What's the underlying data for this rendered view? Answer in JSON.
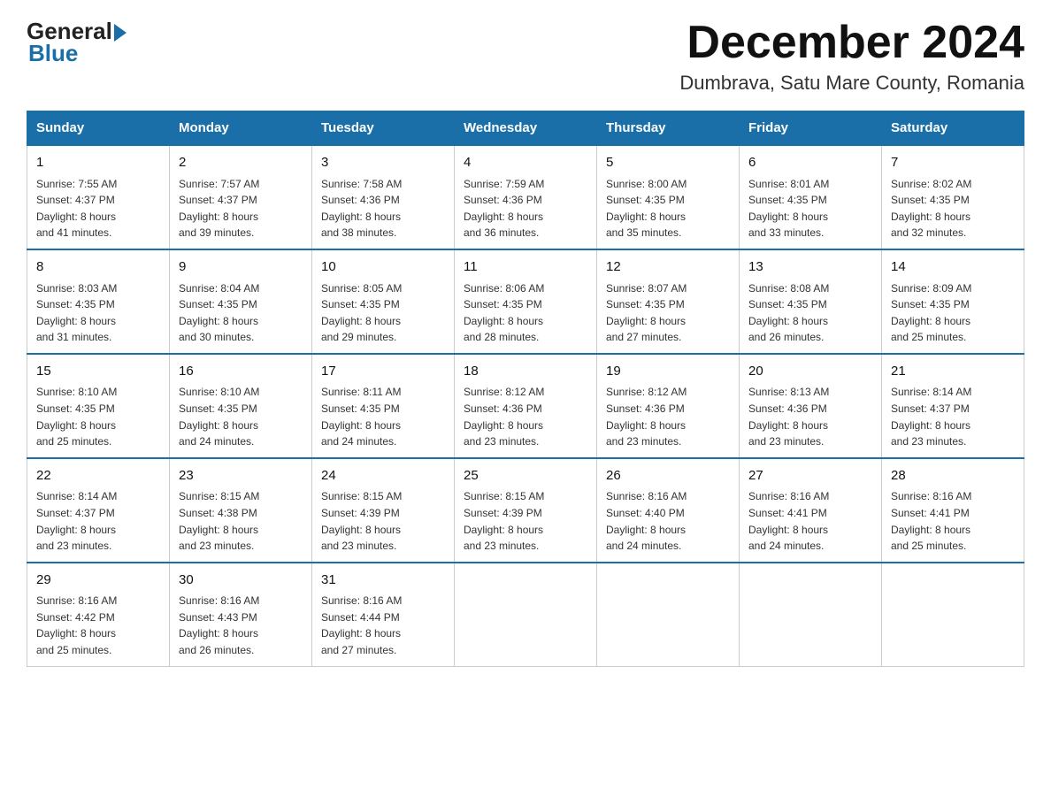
{
  "header": {
    "logo_general": "General",
    "logo_blue": "Blue",
    "title": "December 2024",
    "subtitle": "Dumbrava, Satu Mare County, Romania"
  },
  "days_of_week": [
    "Sunday",
    "Monday",
    "Tuesday",
    "Wednesday",
    "Thursday",
    "Friday",
    "Saturday"
  ],
  "weeks": [
    [
      {
        "day": "1",
        "sunrise": "7:55 AM",
        "sunset": "4:37 PM",
        "daylight": "8 hours and 41 minutes."
      },
      {
        "day": "2",
        "sunrise": "7:57 AM",
        "sunset": "4:37 PM",
        "daylight": "8 hours and 39 minutes."
      },
      {
        "day": "3",
        "sunrise": "7:58 AM",
        "sunset": "4:36 PM",
        "daylight": "8 hours and 38 minutes."
      },
      {
        "day": "4",
        "sunrise": "7:59 AM",
        "sunset": "4:36 PM",
        "daylight": "8 hours and 36 minutes."
      },
      {
        "day": "5",
        "sunrise": "8:00 AM",
        "sunset": "4:35 PM",
        "daylight": "8 hours and 35 minutes."
      },
      {
        "day": "6",
        "sunrise": "8:01 AM",
        "sunset": "4:35 PM",
        "daylight": "8 hours and 33 minutes."
      },
      {
        "day": "7",
        "sunrise": "8:02 AM",
        "sunset": "4:35 PM",
        "daylight": "8 hours and 32 minutes."
      }
    ],
    [
      {
        "day": "8",
        "sunrise": "8:03 AM",
        "sunset": "4:35 PM",
        "daylight": "8 hours and 31 minutes."
      },
      {
        "day": "9",
        "sunrise": "8:04 AM",
        "sunset": "4:35 PM",
        "daylight": "8 hours and 30 minutes."
      },
      {
        "day": "10",
        "sunrise": "8:05 AM",
        "sunset": "4:35 PM",
        "daylight": "8 hours and 29 minutes."
      },
      {
        "day": "11",
        "sunrise": "8:06 AM",
        "sunset": "4:35 PM",
        "daylight": "8 hours and 28 minutes."
      },
      {
        "day": "12",
        "sunrise": "8:07 AM",
        "sunset": "4:35 PM",
        "daylight": "8 hours and 27 minutes."
      },
      {
        "day": "13",
        "sunrise": "8:08 AM",
        "sunset": "4:35 PM",
        "daylight": "8 hours and 26 minutes."
      },
      {
        "day": "14",
        "sunrise": "8:09 AM",
        "sunset": "4:35 PM",
        "daylight": "8 hours and 25 minutes."
      }
    ],
    [
      {
        "day": "15",
        "sunrise": "8:10 AM",
        "sunset": "4:35 PM",
        "daylight": "8 hours and 25 minutes."
      },
      {
        "day": "16",
        "sunrise": "8:10 AM",
        "sunset": "4:35 PM",
        "daylight": "8 hours and 24 minutes."
      },
      {
        "day": "17",
        "sunrise": "8:11 AM",
        "sunset": "4:35 PM",
        "daylight": "8 hours and 24 minutes."
      },
      {
        "day": "18",
        "sunrise": "8:12 AM",
        "sunset": "4:36 PM",
        "daylight": "8 hours and 23 minutes."
      },
      {
        "day": "19",
        "sunrise": "8:12 AM",
        "sunset": "4:36 PM",
        "daylight": "8 hours and 23 minutes."
      },
      {
        "day": "20",
        "sunrise": "8:13 AM",
        "sunset": "4:36 PM",
        "daylight": "8 hours and 23 minutes."
      },
      {
        "day": "21",
        "sunrise": "8:14 AM",
        "sunset": "4:37 PM",
        "daylight": "8 hours and 23 minutes."
      }
    ],
    [
      {
        "day": "22",
        "sunrise": "8:14 AM",
        "sunset": "4:37 PM",
        "daylight": "8 hours and 23 minutes."
      },
      {
        "day": "23",
        "sunrise": "8:15 AM",
        "sunset": "4:38 PM",
        "daylight": "8 hours and 23 minutes."
      },
      {
        "day": "24",
        "sunrise": "8:15 AM",
        "sunset": "4:39 PM",
        "daylight": "8 hours and 23 minutes."
      },
      {
        "day": "25",
        "sunrise": "8:15 AM",
        "sunset": "4:39 PM",
        "daylight": "8 hours and 23 minutes."
      },
      {
        "day": "26",
        "sunrise": "8:16 AM",
        "sunset": "4:40 PM",
        "daylight": "8 hours and 24 minutes."
      },
      {
        "day": "27",
        "sunrise": "8:16 AM",
        "sunset": "4:41 PM",
        "daylight": "8 hours and 24 minutes."
      },
      {
        "day": "28",
        "sunrise": "8:16 AM",
        "sunset": "4:41 PM",
        "daylight": "8 hours and 25 minutes."
      }
    ],
    [
      {
        "day": "29",
        "sunrise": "8:16 AM",
        "sunset": "4:42 PM",
        "daylight": "8 hours and 25 minutes."
      },
      {
        "day": "30",
        "sunrise": "8:16 AM",
        "sunset": "4:43 PM",
        "daylight": "8 hours and 26 minutes."
      },
      {
        "day": "31",
        "sunrise": "8:16 AM",
        "sunset": "4:44 PM",
        "daylight": "8 hours and 27 minutes."
      },
      null,
      null,
      null,
      null
    ]
  ],
  "labels": {
    "sunrise": "Sunrise:",
    "sunset": "Sunset:",
    "daylight": "Daylight:"
  }
}
